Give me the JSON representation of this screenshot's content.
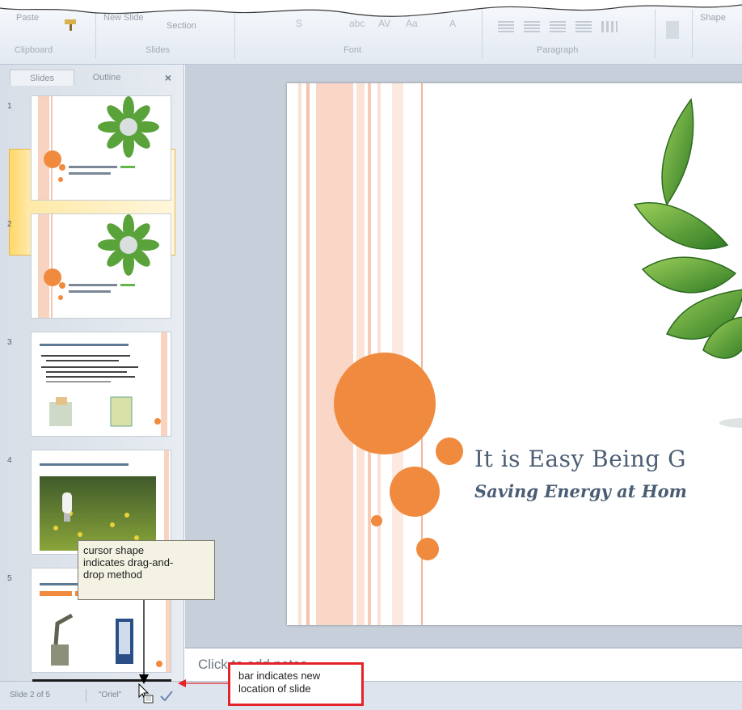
{
  "ribbon": {
    "paste_label": "Paste",
    "new_slide_label": "New Slide",
    "section_label": "Section",
    "font_format_glyphs": [
      "S",
      "abc",
      "AV",
      "Aa",
      "A"
    ],
    "shapes_label": "Shape",
    "groups": [
      "Clipboard",
      "Slides",
      "Font",
      "Paragraph"
    ]
  },
  "panel": {
    "tabs": [
      "Slides",
      "Outline"
    ],
    "close_glyph": "×",
    "slide_numbers": [
      "1",
      "2",
      "3",
      "4",
      "5"
    ],
    "selected_index": 1
  },
  "slide": {
    "title": "It is Easy Being G",
    "subtitle": "Saving Energy at Hom"
  },
  "notes": {
    "placeholder": "Click to add notes"
  },
  "status": {
    "slide_position": "Slide 2 of 5",
    "theme": "\"Oriel\""
  },
  "callouts": {
    "cursor": [
      "cursor shape",
      "indicates drag-and-",
      "drop method"
    ],
    "bar": [
      "bar indicates new",
      "location of slide"
    ]
  },
  "colors": {
    "accent_orange": "#f08a3e",
    "leaf_green": "#4e9a2f",
    "callout_red": "#e3222a",
    "title_blue": "#4b5d74"
  }
}
